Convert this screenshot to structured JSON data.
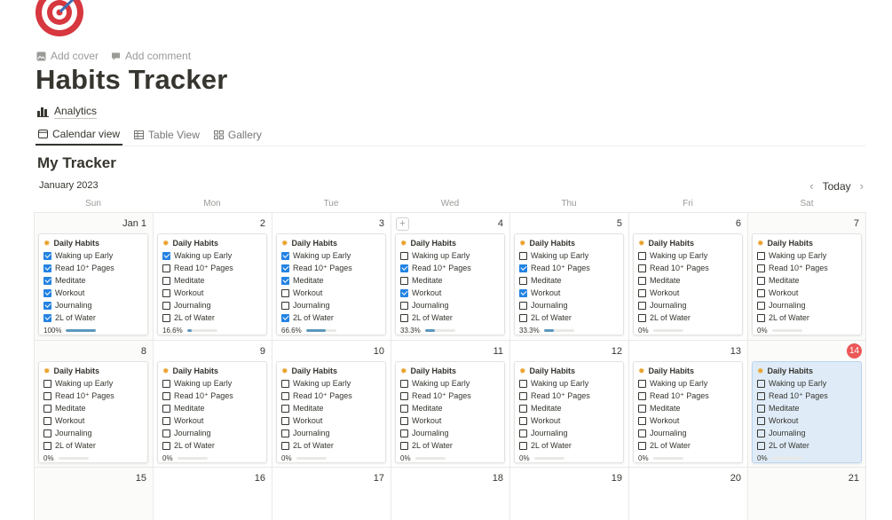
{
  "page": {
    "icon": "target-bullseye-icon",
    "add_cover": "Add cover",
    "add_comment": "Add comment",
    "title": "Habits Tracker",
    "analytics_link": "Analytics"
  },
  "views": [
    {
      "label": "Calendar view",
      "icon": "calendar-icon",
      "active": true
    },
    {
      "label": "Table View",
      "icon": "table-icon",
      "active": false
    },
    {
      "label": "Gallery",
      "icon": "gallery-icon",
      "active": false
    }
  ],
  "database": {
    "title": "My Tracker",
    "month": "January 2023",
    "today_button": "Today",
    "weekdays": [
      "Sun",
      "Mon",
      "Tue",
      "Wed",
      "Thu",
      "Fri",
      "Sat"
    ]
  },
  "colors": {
    "accent": "#2383e2",
    "today_badge": "#eb5757",
    "progress": "#5b97bd",
    "selected_card": "#dfecf8",
    "habit_icon": "#e9a12b"
  },
  "habit_names": [
    "Waking up Early",
    "Read 10⁺ Pages",
    "Meditate",
    "Workout",
    "Journaling",
    "2L of Water"
  ],
  "weeks": [
    [
      {
        "day": "Jan 1",
        "card": {
          "title": "Daily Habits",
          "checks": [
            true,
            true,
            true,
            true,
            true,
            true
          ],
          "progress_label": "100%",
          "progress": 1.0
        }
      },
      {
        "day": "2",
        "card": {
          "title": "Daily Habits",
          "checks": [
            true,
            false,
            false,
            false,
            false,
            false
          ],
          "progress_label": "16.6%",
          "progress": 0.166
        }
      },
      {
        "day": "3",
        "card": {
          "title": "Daily Habits",
          "checks": [
            true,
            true,
            true,
            false,
            false,
            true
          ],
          "progress_label": "66.6%",
          "progress": 0.666
        }
      },
      {
        "day": "4",
        "add": true,
        "card": {
          "title": "Daily Habits",
          "checks": [
            false,
            true,
            false,
            true,
            false,
            false
          ],
          "progress_label": "33.3%",
          "progress": 0.333
        }
      },
      {
        "day": "5",
        "card": {
          "title": "Daily Habits",
          "checks": [
            false,
            true,
            false,
            true,
            false,
            false
          ],
          "progress_label": "33.3%",
          "progress": 0.333
        }
      },
      {
        "day": "6",
        "card": {
          "title": "Daily Habits",
          "checks": [
            false,
            false,
            false,
            false,
            false,
            false
          ],
          "progress_label": "0%",
          "progress": 0
        }
      },
      {
        "day": "7",
        "card": {
          "title": "Daily Habits",
          "checks": [
            false,
            false,
            false,
            false,
            false,
            false
          ],
          "progress_label": "0%",
          "progress": 0
        }
      }
    ],
    [
      {
        "day": "8",
        "card": {
          "title": "Daily Habits",
          "checks": [
            false,
            false,
            false,
            false,
            false,
            false
          ],
          "progress_label": "0%",
          "progress": 0
        }
      },
      {
        "day": "9",
        "card": {
          "title": "Daily Habits",
          "checks": [
            false,
            false,
            false,
            false,
            false,
            false
          ],
          "progress_label": "0%",
          "progress": 0
        }
      },
      {
        "day": "10",
        "card": {
          "title": "Daily Habits",
          "checks": [
            false,
            false,
            false,
            false,
            false,
            false
          ],
          "progress_label": "0%",
          "progress": 0
        }
      },
      {
        "day": "11",
        "card": {
          "title": "Daily Habits",
          "checks": [
            false,
            false,
            false,
            false,
            false,
            false
          ],
          "progress_label": "0%",
          "progress": 0
        }
      },
      {
        "day": "12",
        "card": {
          "title": "Daily Habits",
          "checks": [
            false,
            false,
            false,
            false,
            false,
            false
          ],
          "progress_label": "0%",
          "progress": 0
        }
      },
      {
        "day": "13",
        "card": {
          "title": "Daily Habits",
          "checks": [
            false,
            false,
            false,
            false,
            false,
            false
          ],
          "progress_label": "0%",
          "progress": 0
        }
      },
      {
        "day": "14",
        "today": true,
        "card": {
          "title": "Daily Habits",
          "selected": true,
          "checks": [
            false,
            false,
            false,
            false,
            false,
            false
          ],
          "progress_label": "0%",
          "progress": 0
        }
      }
    ],
    [
      {
        "day": "15"
      },
      {
        "day": "16"
      },
      {
        "day": "17"
      },
      {
        "day": "18"
      },
      {
        "day": "19"
      },
      {
        "day": "20"
      },
      {
        "day": "21"
      }
    ]
  ]
}
